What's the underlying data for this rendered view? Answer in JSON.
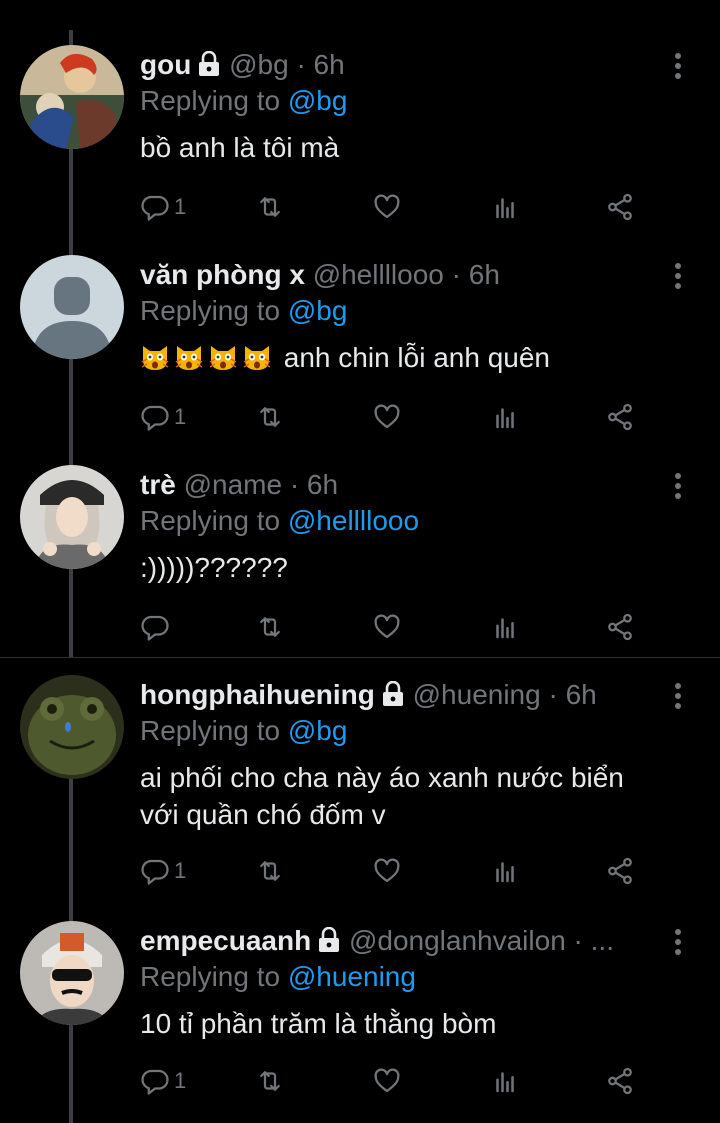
{
  "tweets": [
    {
      "name": "gou",
      "locked": true,
      "handle": "@bg",
      "time": "· 6h",
      "replying_prefix": "Replying to",
      "replying_to": "@bg",
      "text": "bồ anh là tôi mà",
      "reply_count": "1",
      "avatar": "illustration-avatar"
    },
    {
      "name": "văn phòng x",
      "locked": false,
      "handle": "@hellllooo",
      "time": "· 6h",
      "replying_prefix": "Replying to",
      "replying_to": "@bg",
      "emoji": [
        "scream-cat",
        "scream-cat",
        "scream-cat",
        "scream-cat"
      ],
      "text": "anh chin lỗi anh quên",
      "reply_count": "1",
      "avatar": "default-avatar"
    },
    {
      "name": "trè",
      "locked": false,
      "handle": "@name",
      "time": "· 6h",
      "replying_prefix": "Replying to",
      "replying_to": "@hellllooo",
      "text": ":)))))??????",
      "reply_count": "",
      "avatar": "photo-avatar"
    },
    {
      "name": "hongphaihuening",
      "locked": true,
      "handle": "@huening",
      "time": "· 6h",
      "replying_prefix": "Replying to",
      "replying_to": "@bg",
      "text_lines": [
        "ai phối cho cha này áo xanh nước biển",
        "với quần chó đốm v"
      ],
      "reply_count": "1",
      "avatar": "frog-avatar"
    },
    {
      "name": "empecuaanh",
      "locked": true,
      "handle": "@donglanhvailon · ...",
      "time": "",
      "replying_prefix": "Replying to",
      "replying_to": "@huening",
      "text": "10 tỉ phần trăm là thằng bòm",
      "reply_count": "1",
      "avatar": "photo-avatar-2"
    }
  ],
  "icons": [
    "reply-icon",
    "retweet-icon",
    "like-icon",
    "analytics-icon",
    "share-icon",
    "more-icon",
    "lock-icon"
  ],
  "colors": {
    "background": "#000000",
    "text": "#e7e9ea",
    "muted": "#71767b",
    "link": "#1d9bf0",
    "thread": "#3b3f43"
  }
}
